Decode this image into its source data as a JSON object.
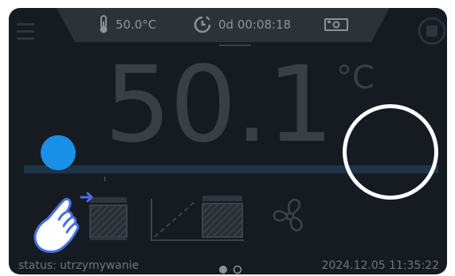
{
  "status_bar": {
    "temperature": "50.0°C",
    "timer": "0d 00:08:18",
    "icons": [
      "thermometer-icon",
      "clock-icon",
      "camera-icon"
    ]
  },
  "main": {
    "current_temperature": "50.1",
    "unit": "°C"
  },
  "footer": {
    "status": "status: utrzymywanie",
    "datetime": "2024.12.05  11:35:22",
    "pagination": {
      "total": 2,
      "active": 1
    }
  },
  "tiles": [
    "hold-program-icon",
    "ramp-program-icon",
    "fan-icon"
  ],
  "colors": {
    "screen_bg": "#161b22",
    "status_bar_bg": "#2d3239",
    "dim_text": "#8d939b",
    "progress_track": "#1e3448",
    "touch_indicator": "#1990e8",
    "hand_outline": "#4a6fe3"
  }
}
